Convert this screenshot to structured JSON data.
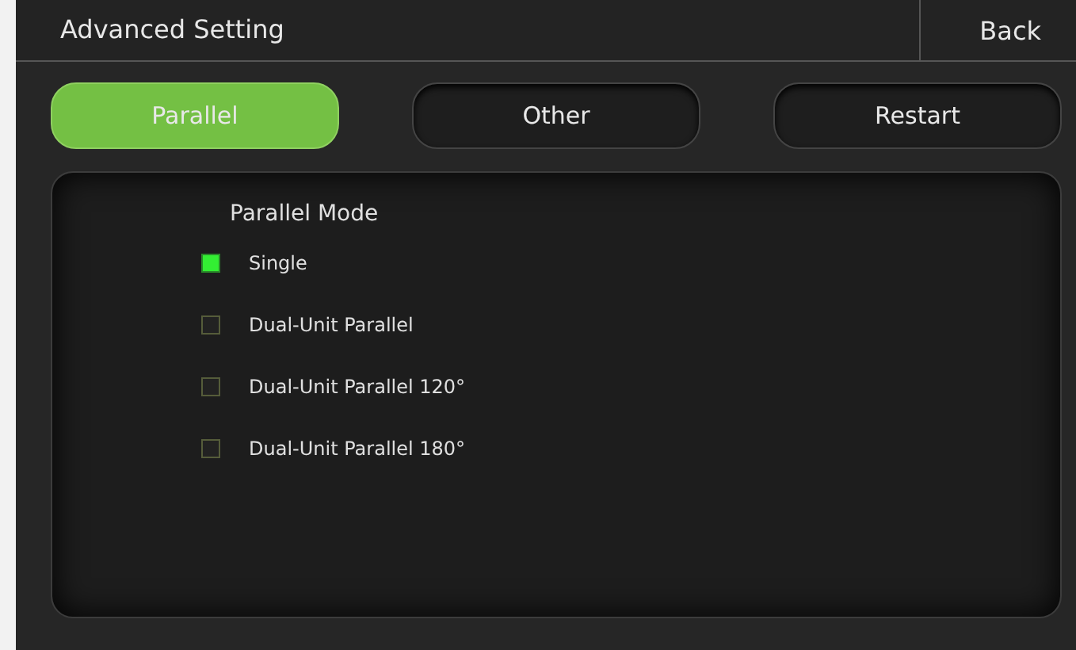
{
  "header": {
    "title": "Advanced Setting",
    "back": "Back"
  },
  "tabs": [
    {
      "label": "Parallel",
      "selected": true
    },
    {
      "label": "Other",
      "selected": false
    },
    {
      "label": "Restart",
      "selected": false
    }
  ],
  "panel": {
    "heading": "Parallel Mode",
    "options": [
      {
        "label": "Single",
        "selected": true
      },
      {
        "label": "Dual-Unit Parallel",
        "selected": false
      },
      {
        "label": "Dual-Unit Parallel 120°",
        "selected": false
      },
      {
        "label": "Dual-Unit Parallel 180°",
        "selected": false
      }
    ]
  }
}
